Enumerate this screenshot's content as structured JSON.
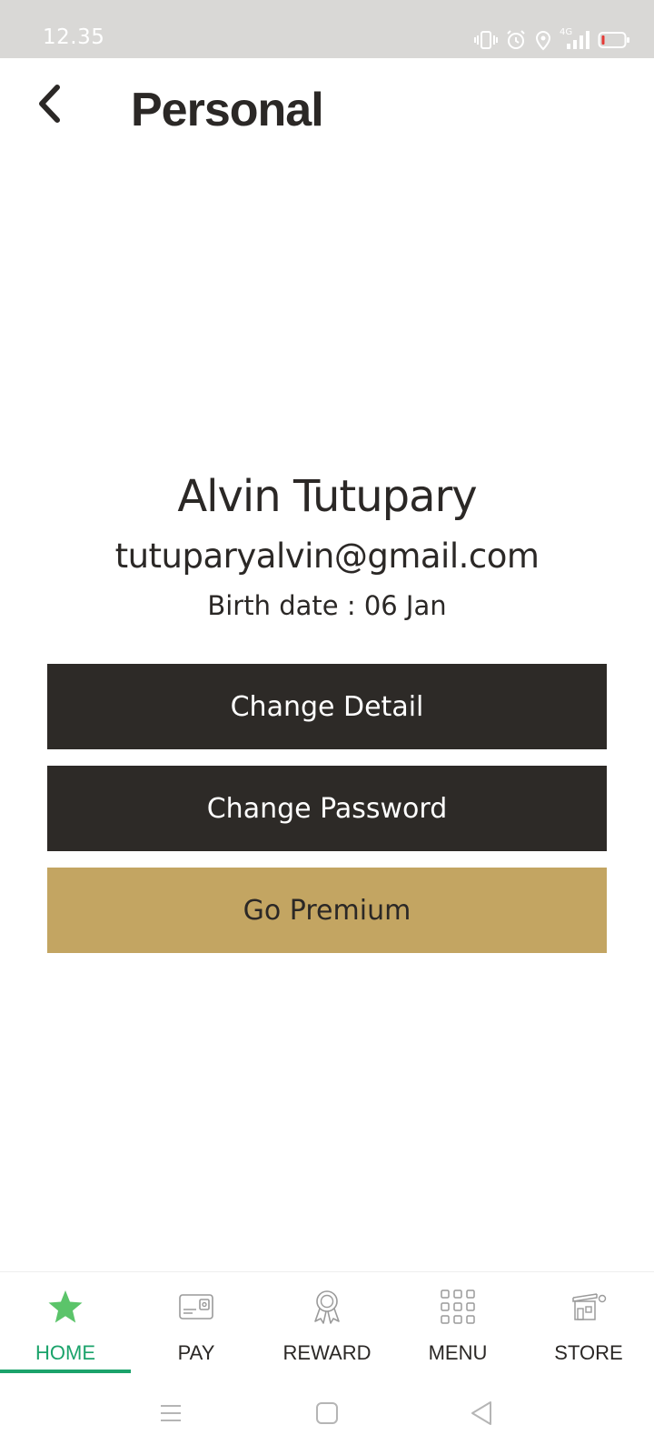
{
  "status_bar": {
    "time": "12.35",
    "network_label": "4G"
  },
  "header": {
    "title": "Personal"
  },
  "profile": {
    "name": "Alvin Tutupary",
    "email": "tutuparyalvin@gmail.com",
    "birth_label": "Birth date : ",
    "birth_value": "06 Jan"
  },
  "actions": {
    "change_detail": "Change Detail",
    "change_password": "Change Password",
    "go_premium": "Go Premium"
  },
  "bottom_nav": {
    "items": [
      {
        "label": "HOME",
        "icon": "star-icon",
        "active": true
      },
      {
        "label": "PAY",
        "icon": "card-icon",
        "active": false
      },
      {
        "label": "REWARD",
        "icon": "award-ribbon-icon",
        "active": false
      },
      {
        "label": "MENU",
        "icon": "grid-icon",
        "active": false
      },
      {
        "label": "STORE",
        "icon": "store-icon",
        "active": false
      }
    ]
  },
  "colors": {
    "active_nav": "#1ba36b",
    "dark_button": "#2d2a27",
    "premium_button": "#c3a562",
    "status_bar": "#d9d8d6",
    "star": "#5bc46a"
  }
}
